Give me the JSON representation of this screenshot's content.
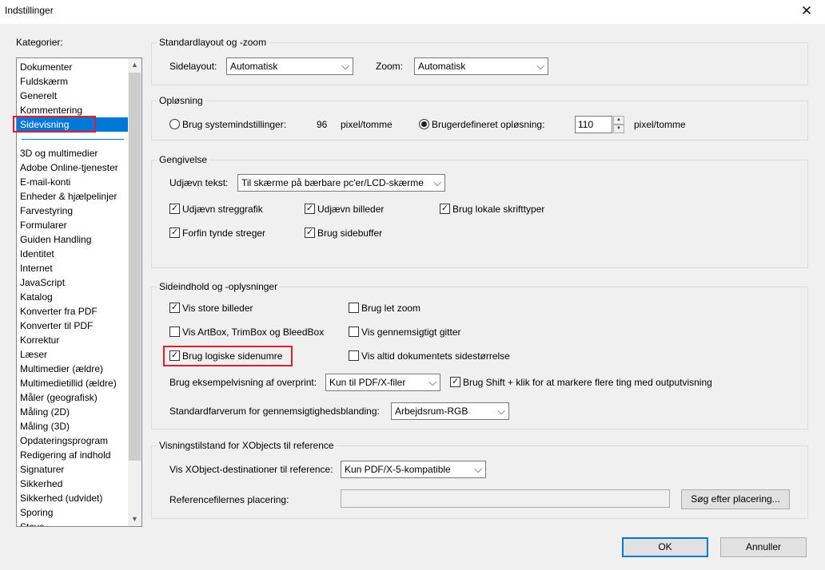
{
  "window": {
    "title": "Indstillinger",
    "close_glyph": "✕"
  },
  "categories": {
    "label": "Kategorier:",
    "items": [
      "Dokumenter",
      "Fuldskærm",
      "Generelt",
      "Kommentering",
      "Sidevisning",
      "3D og multimedier",
      "Adobe Online-tjenester",
      "E-mail-konti",
      "Enheder & hjælpelinjer",
      "Farvestyring",
      "Formularer",
      "Guiden Handling",
      "Identitet",
      "Internet",
      "JavaScript",
      "Katalog",
      "Konverter fra PDF",
      "Konverter til PDF",
      "Korrektur",
      "Læser",
      "Multimedier (ældre)",
      "Multimedietillid (ældre)",
      "Måler (geografisk)",
      "Måling (2D)",
      "Måling (3D)",
      "Opdateringsprogram",
      "Redigering af indhold",
      "Signaturer",
      "Sikkerhed",
      "Sikkerhed (udvidet)",
      "Sporing",
      "Stave"
    ],
    "selected": "Sidevisning",
    "scroll_up": "▲",
    "scroll_down": "▼"
  },
  "layout_zoom": {
    "title": "Standardlayout og -zoom",
    "page_layout_label": "Sidelayout:",
    "page_layout_value": "Automatisk",
    "zoom_label": "Zoom:",
    "zoom_value": "Automatisk"
  },
  "resolution": {
    "title": "Opløsning",
    "system_label": "Brug systemindstillinger:",
    "system_value": "96",
    "system_unit": "pixel/tomme",
    "custom_label": "Brugerdefineret opløsning:",
    "custom_value": "110",
    "custom_unit": "pixel/tomme",
    "selected": "custom"
  },
  "rendering": {
    "title": "Gengivelse",
    "smooth_text_label": "Udjævn tekst:",
    "smooth_text_value": "Til skærme på bærbare pc'er/LCD-skærme",
    "options": [
      {
        "label": "Udjævn streggrafik",
        "checked": true
      },
      {
        "label": "Udjævn billeder",
        "checked": true
      },
      {
        "label": "Brug lokale skrifttyper",
        "checked": true
      },
      {
        "label": "Forfin tynde streger",
        "checked": true
      },
      {
        "label": "Brug sidebuffer",
        "checked": true
      }
    ]
  },
  "page_content": {
    "title": "Sideindhold og -oplysninger",
    "options": [
      {
        "label": "Vis store billeder",
        "checked": true
      },
      {
        "label": "Brug let zoom",
        "checked": false
      },
      {
        "label": "Vis ArtBox, TrimBox og BleedBox",
        "checked": false
      },
      {
        "label": "Vis gennemsigtigt gitter",
        "checked": false
      },
      {
        "label": "Brug logiske sidenumre",
        "checked": true
      },
      {
        "label": "Vis altid dokumentets sidestørrelse",
        "checked": false
      }
    ],
    "overprint_label": "Brug eksempelvisning af overprint:",
    "overprint_value": "Kun til PDF/X-filer",
    "shift_click_label": "Brug Shift + klik for at markere flere ting med outputvisning",
    "shift_click_checked": true,
    "blend_label": "Standardfarverum for gennemsigtighedsblanding:",
    "blend_value": "Arbejdsrum-RGB"
  },
  "xobjects": {
    "title": "Visningstilstand for XObjects til reference",
    "dest_label": "Vis XObject-destinationer til reference:",
    "dest_value": "Kun PDF/X-5-kompatible",
    "location_label": "Referencefilernes placering:",
    "location_value": "",
    "browse_label": "Søg efter placering..."
  },
  "footer": {
    "ok_label": "OK",
    "cancel_label": "Annuller"
  },
  "icons": {
    "dropdown": "⌵",
    "check": "✓",
    "spin_up": "▲",
    "spin_down": "▼"
  },
  "colors": {
    "selection": "#0078d7",
    "highlight": "#e01d2d",
    "background": "#f0f0f0"
  }
}
